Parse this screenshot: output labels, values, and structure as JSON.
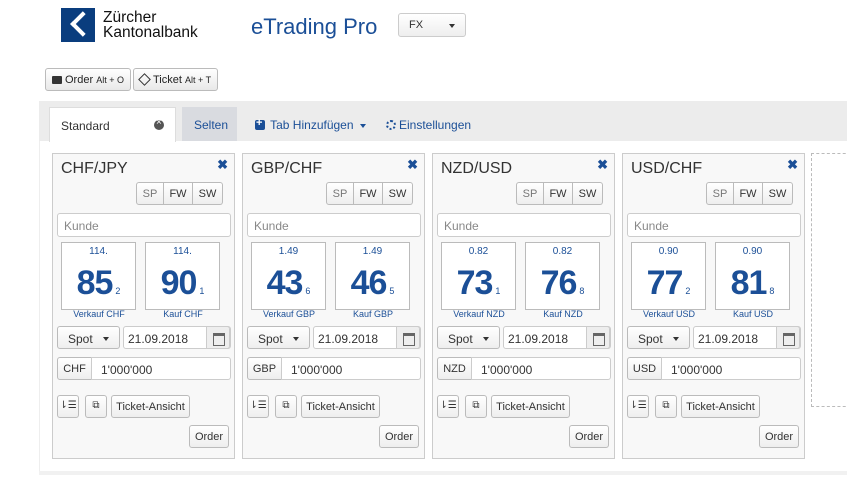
{
  "header": {
    "logo_line1": "Zürcher",
    "logo_line2": "Kantonalbank",
    "app_title": "eTrading Pro",
    "market_select": "FX"
  },
  "toolbar": {
    "order_label": "Order",
    "order_shortcut": "Alt + O",
    "ticket_label": "Ticket",
    "ticket_shortcut": "Alt + T"
  },
  "tabs": {
    "active": "Standard",
    "selten": "Selten",
    "add_tab": "Tab Hinzufügen",
    "settings": "Einstellungen"
  },
  "panels": [
    {
      "pair": "CHF/JPY",
      "seg": [
        "SP",
        "FW",
        "SW"
      ],
      "customer_placeholder": "Kunde",
      "sell": {
        "prefix": "114.",
        "big": "85",
        "pip": "2",
        "label": "Verkauf CHF"
      },
      "buy": {
        "prefix": "114.",
        "big": "90",
        "pip": "1",
        "label": "Kauf CHF"
      },
      "tenor": "Spot",
      "date": "21.09.2018",
      "currency": "CHF",
      "amount": "1'000'000",
      "ticket_view": "Ticket-Ansicht",
      "order": "Order"
    },
    {
      "pair": "GBP/CHF",
      "seg": [
        "SP",
        "FW",
        "SW"
      ],
      "customer_placeholder": "Kunde",
      "sell": {
        "prefix": "1.49",
        "big": "43",
        "pip": "6",
        "label": "Verkauf GBP"
      },
      "buy": {
        "prefix": "1.49",
        "big": "46",
        "pip": "5",
        "label": "Kauf GBP"
      },
      "tenor": "Spot",
      "date": "21.09.2018",
      "currency": "GBP",
      "amount": "1'000'000",
      "ticket_view": "Ticket-Ansicht",
      "order": "Order"
    },
    {
      "pair": "NZD/USD",
      "seg": [
        "SP",
        "FW",
        "SW"
      ],
      "customer_placeholder": "Kunde",
      "sell": {
        "prefix": "0.82",
        "big": "73",
        "pip": "1",
        "label": "Verkauf NZD"
      },
      "buy": {
        "prefix": "0.82",
        "big": "76",
        "pip": "8",
        "label": "Kauf NZD"
      },
      "tenor": "Spot",
      "date": "21.09.2018",
      "currency": "NZD",
      "amount": "1'000'000",
      "ticket_view": "Ticket-Ansicht",
      "order": "Order"
    },
    {
      "pair": "USD/CHF",
      "seg": [
        "SP",
        "FW",
        "SW"
      ],
      "customer_placeholder": "Kunde",
      "sell": {
        "prefix": "0.90",
        "big": "77",
        "pip": "2",
        "label": "Verkauf USD"
      },
      "buy": {
        "prefix": "0.90",
        "big": "81",
        "pip": "8",
        "label": "Kauf USD"
      },
      "tenor": "Spot",
      "date": "21.09.2018",
      "currency": "USD",
      "amount": "1'000'000",
      "ticket_view": "Ticket-Ansicht",
      "order": "Order"
    }
  ]
}
